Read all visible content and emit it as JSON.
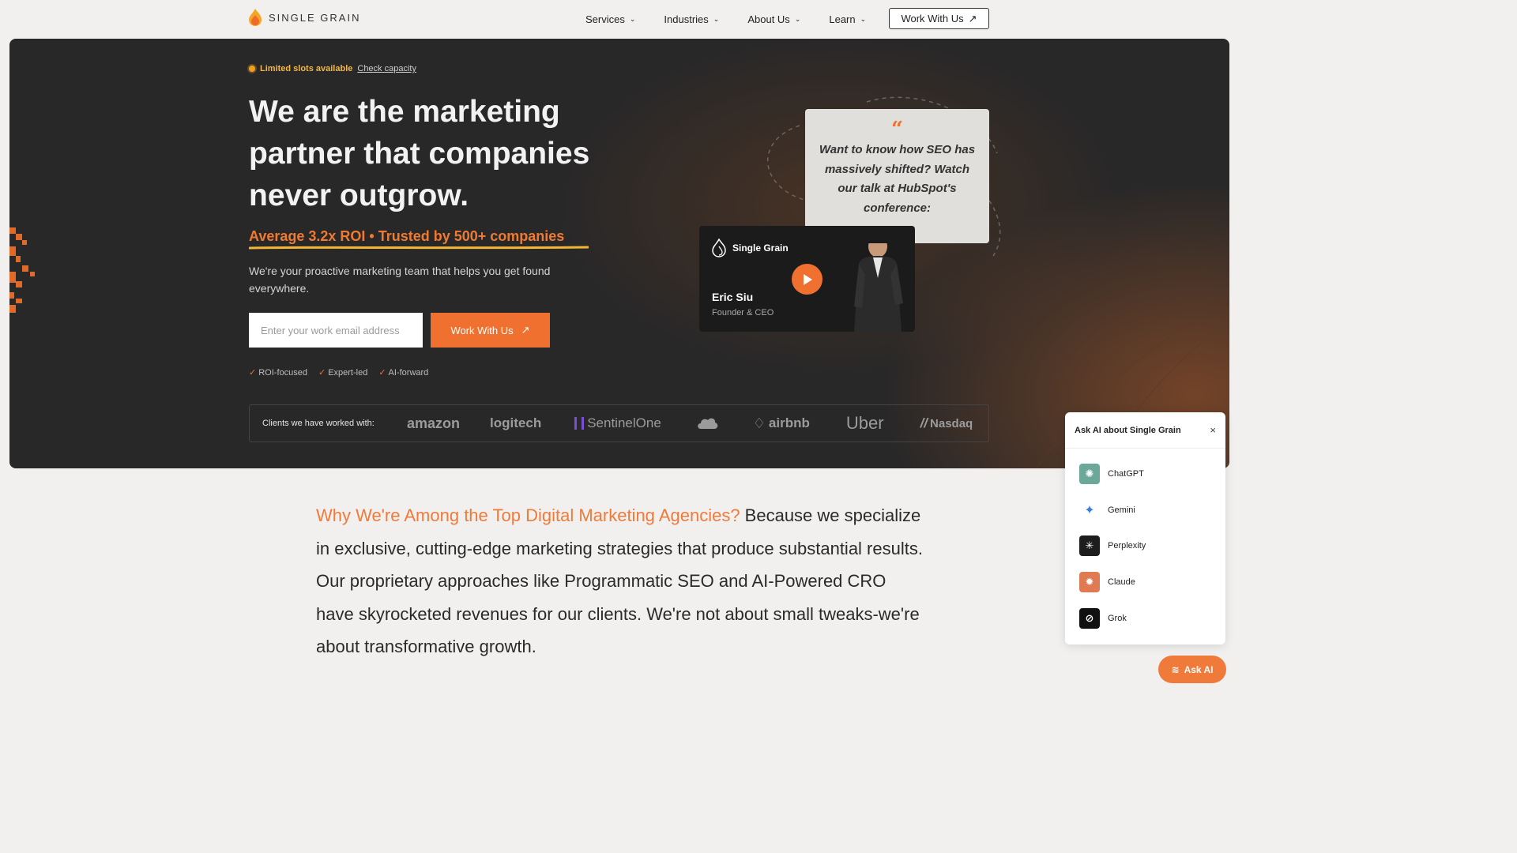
{
  "brand": {
    "name": "SINGLE GRAIN"
  },
  "nav": {
    "items": [
      {
        "label": "Services"
      },
      {
        "label": "Industries"
      },
      {
        "label": "About Us"
      },
      {
        "label": "Learn"
      }
    ],
    "cta": "Work With Us"
  },
  "hero": {
    "slots_text": "Limited slots available",
    "slots_link": "Check capacity",
    "title": "We are the marketing partner that companies never outgrow.",
    "roi_line": "Average 3.2x ROI • Trusted by 500+ companies",
    "description": "We're your proactive marketing team that helps you get found everywhere.",
    "email_placeholder": "Enter your work email address",
    "cta": "Work With Us",
    "checks": [
      "ROI-focused",
      "Expert-led",
      "AI-forward"
    ]
  },
  "quote": {
    "mark": "“",
    "text": "Want to know how SEO has massively shifted? Watch our talk at HubSpot's conference:"
  },
  "video": {
    "brand": "Single Grain",
    "speaker_name": "Eric Siu",
    "speaker_role": "Founder & CEO"
  },
  "clients": {
    "label": "Clients we have worked with:",
    "logos": [
      "amazon",
      "logitech",
      "SentinelOne",
      "salesforce",
      "airbnb",
      "Uber",
      "Nasdaq"
    ]
  },
  "why": {
    "accent": "Why We're Among the Top Digital Marketing Agencies?",
    "body": " Because we specialize in exclusive, cutting-edge marketing strategies that produce substantial results. Our proprietary approaches like Programmatic SEO and AI-Powered CRO have skyrocketed revenues for our clients. We're not about small tweaks-we're about transformative growth."
  },
  "ask_ai": {
    "title": "Ask AI about Single Grain",
    "close": "×",
    "items": [
      {
        "label": "ChatGPT",
        "icon": "chatgpt-icon"
      },
      {
        "label": "Gemini",
        "icon": "gemini-icon"
      },
      {
        "label": "Perplexity",
        "icon": "perplexity-icon"
      },
      {
        "label": "Claude",
        "icon": "claude-icon"
      },
      {
        "label": "Grok",
        "icon": "grok-icon"
      }
    ],
    "button": "Ask AI"
  },
  "colors": {
    "accent": "#f07030",
    "hero_bg": "#292828",
    "page_bg": "#f1f0ef"
  }
}
